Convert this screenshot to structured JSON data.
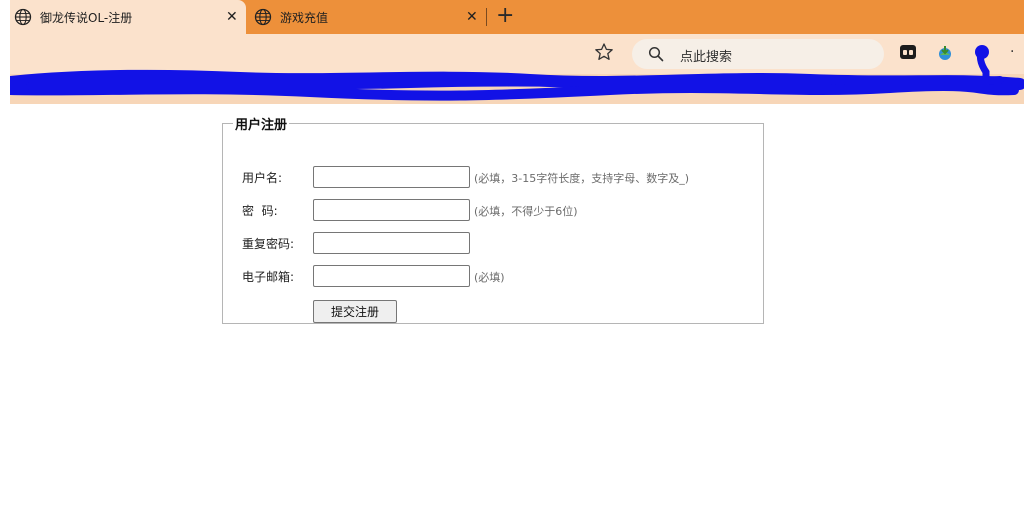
{
  "browser": {
    "tabs": [
      {
        "title": "御龙传说OL-注册",
        "active": true,
        "close": "✕"
      },
      {
        "title": "游戏充值",
        "active": false,
        "close": "✕"
      }
    ],
    "new_tab": "+",
    "search_placeholder": "点此搜索",
    "colors": {
      "tabstrip": "#ed903a",
      "toolbar": "#fbe2cc",
      "scribble": "#1212e6"
    }
  },
  "form": {
    "legend": "用户注册",
    "fields": [
      {
        "label": "用户名:",
        "value": "",
        "hint": "(必填，3-15字符长度，支持字母、数字及_)"
      },
      {
        "label": "密  码:",
        "value": "",
        "hint": "(必填，不得少于6位)"
      },
      {
        "label": "重复密码:",
        "value": "",
        "hint": ""
      },
      {
        "label": "电子邮箱:",
        "value": "",
        "hint": "(必填)"
      }
    ],
    "submit_label": "提交注册"
  }
}
